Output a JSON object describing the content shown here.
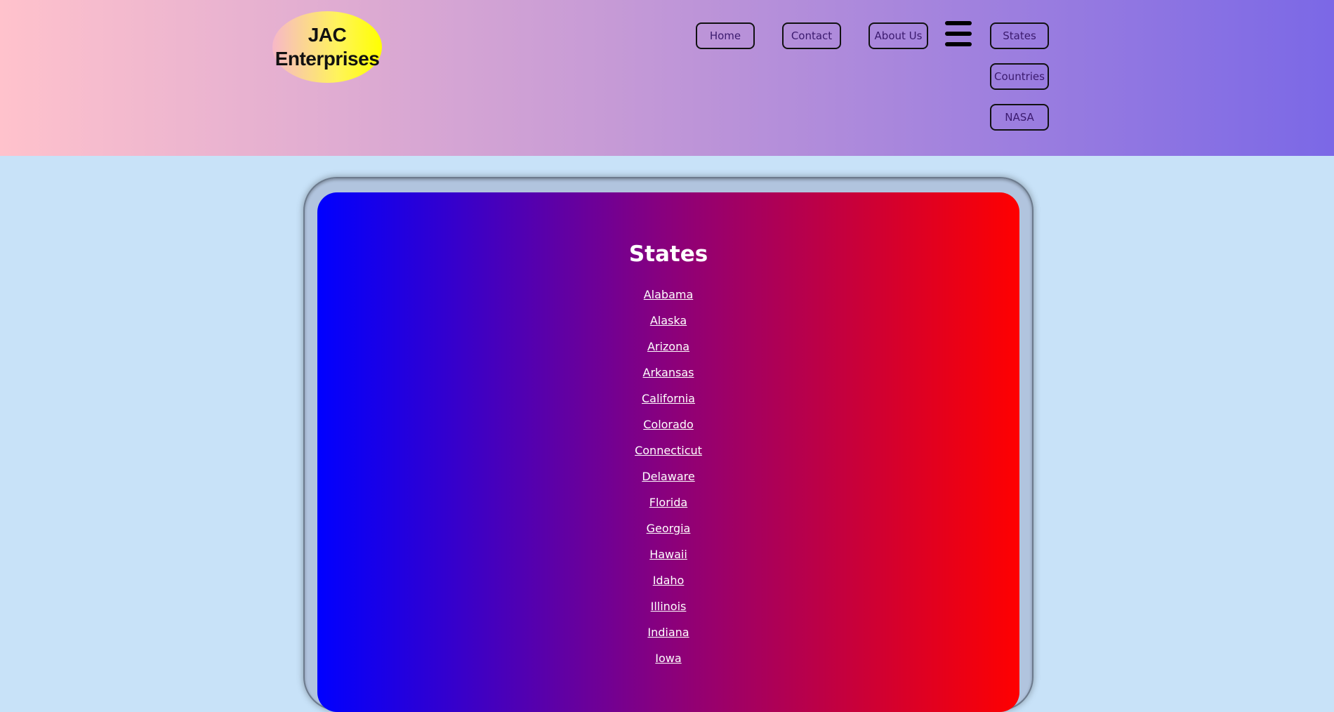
{
  "header": {
    "logo_text": "JAC\nEnterprises",
    "gradient_colors": [
      "#ffc2cc",
      "#c79bd6",
      "#7b68e6"
    ]
  },
  "nav": {
    "home": "Home",
    "contact": "Contact",
    "about": "About Us",
    "menu_icon": "hamburger-menu-icon",
    "dropdown": [
      "States",
      "Countries",
      "NASA"
    ]
  },
  "main": {
    "title": "States",
    "states": [
      "Alabama",
      "Alaska",
      "Arizona",
      "Arkansas",
      "California",
      "Colorado",
      "Connecticut",
      "Delaware",
      "Florida",
      "Georgia",
      "Hawaii",
      "Idaho",
      "Illinois",
      "Indiana",
      "Iowa"
    ],
    "panel_gradient": [
      "#0000ff",
      "#8a007c",
      "#ff0000"
    ]
  }
}
